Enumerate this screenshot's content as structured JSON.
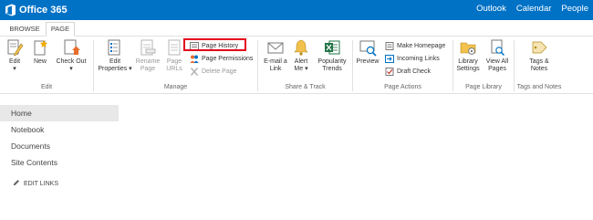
{
  "suitebar": {
    "app_name": "Office 365",
    "nav": [
      "Outlook",
      "Calendar",
      "People"
    ],
    "color": "#0072c6"
  },
  "tabs": {
    "browse": "BROWSE",
    "page": "PAGE"
  },
  "ribbon": {
    "edit_group": {
      "label": "Edit",
      "edit": "Edit",
      "new": "New",
      "check_out_1": "Check Out",
      "check_out_2": "▾"
    },
    "manage_group": {
      "label": "Manage",
      "edit_properties_1": "Edit",
      "edit_properties_2": "Properties ▾",
      "rename_1": "Rename",
      "rename_2": "Page",
      "page_urls_1": "Page",
      "page_urls_2": "URLs",
      "page_history": "Page History",
      "page_permissions": "Page Permissions",
      "delete_page": "Delete Page"
    },
    "share_group": {
      "label": "Share & Track",
      "email_1": "E-mail a",
      "email_2": "Link",
      "alert_1": "Alert",
      "alert_2": "Me ▾",
      "popularity_1": "Popularity",
      "popularity_2": "Trends"
    },
    "actions_group": {
      "label": "Page Actions",
      "preview": "Preview",
      "make_homepage": "Make Homepage",
      "incoming_links": "Incoming Links",
      "draft_check": "Draft Check"
    },
    "library_group": {
      "label": "Page Library",
      "library_settings_1": "Library",
      "library_settings_2": "Settings",
      "view_all_1": "View All",
      "view_all_2": "Pages"
    },
    "tags_group": {
      "label": "Tags and Notes",
      "tags_1": "Tags &",
      "tags_2": "Notes"
    }
  },
  "leftnav": {
    "items": [
      "Home",
      "Notebook",
      "Documents",
      "Site Contents"
    ],
    "edit_links": "EDIT LINKS"
  },
  "colors": {
    "highlight": "#e3001b",
    "accent": "#0072c6"
  }
}
